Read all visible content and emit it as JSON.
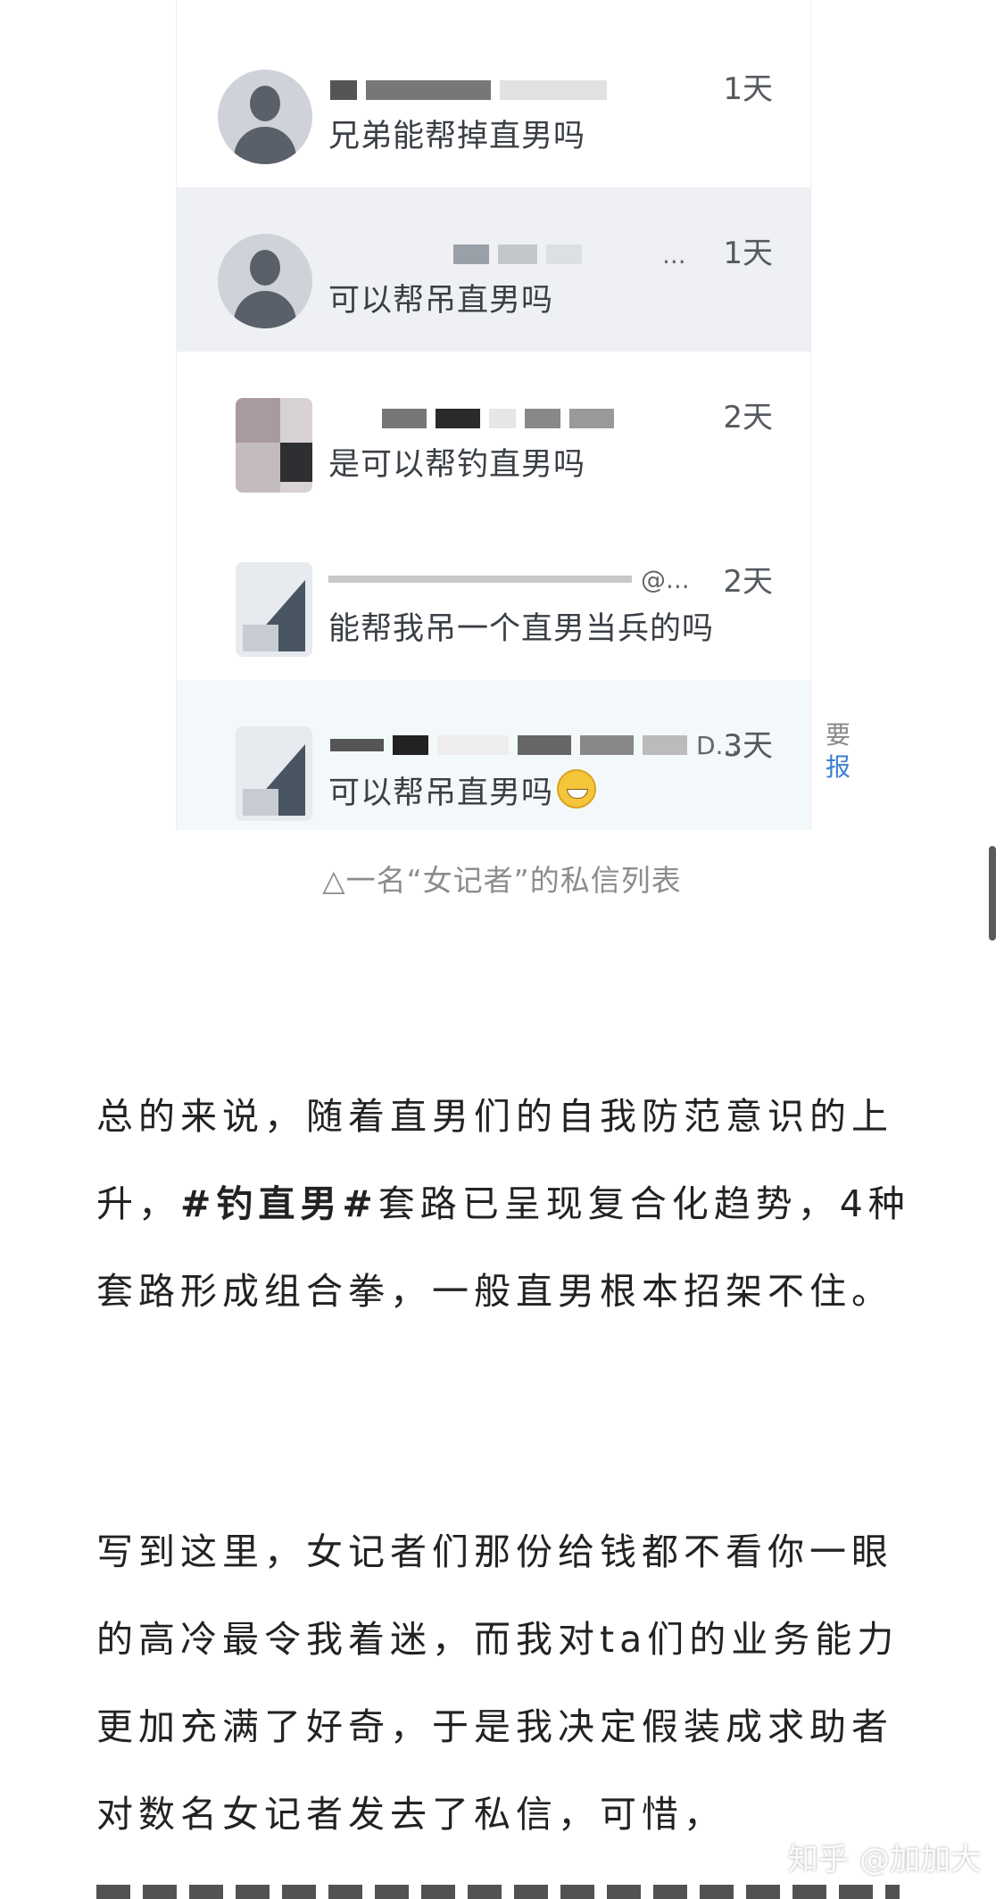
{
  "dm_list": {
    "rows": [
      {
        "time": "1天",
        "message": "兄弟能帮掉直男吗"
      },
      {
        "time": "1天",
        "message": "可以帮吊直男吗",
        "name_suffix": "..."
      },
      {
        "time": "2天",
        "message": "是可以帮钓直男吗"
      },
      {
        "time": "2天",
        "message": "能帮我吊一个直男当兵的吗",
        "name_suffix": "@..."
      },
      {
        "time": "3天",
        "message": "可以帮吊直男吗",
        "name_suffix": "D..."
      }
    ],
    "side_fragment": [
      "要",
      "报"
    ]
  },
  "caption": "△一名“女记者”的私信列表",
  "article": {
    "para1_a": "总的来说，随着直男们的自我防范意识的上升，",
    "para1_hashtag": "#钓直男#",
    "para1_b": "套路已呈现复合化趋势，4种套路形成组合拳，一般直男根本招架不住。",
    "para2": "写到这里，女记者们那份给钱都不看你一眼的高冷最令我着迷，而我对ta们的业务能力更加充满了好奇，于是我决定假装成求助者对数名女记者发去了私信，可惜，"
  },
  "watermark": {
    "site": "知乎",
    "author": "@加加大"
  }
}
